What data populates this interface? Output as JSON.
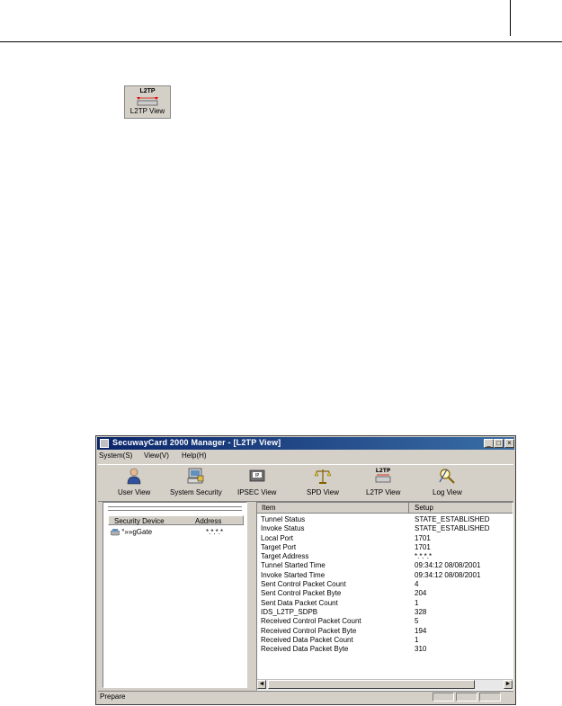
{
  "page": {
    "hero_icon_top": "L2TP",
    "hero_icon_label": "L2TP View"
  },
  "window": {
    "title": "SecuwayCard 2000 Manager - [L2TP View]",
    "menu": [
      "System(S)",
      "View(V)",
      "Help(H)"
    ],
    "toolbar": [
      {
        "label": "User View",
        "icon": "user-icon"
      },
      {
        "label": "System Security",
        "icon": "computer-lock-icon"
      },
      {
        "label": "IPSEC View",
        "icon": "ipsec-icon"
      },
      {
        "label": "SPD View",
        "icon": "scales-icon"
      },
      {
        "label": "L2TP View",
        "icon": "l2tp-icon"
      },
      {
        "label": "Log View",
        "icon": "magnifier-tools-icon"
      }
    ],
    "left": {
      "columns": [
        "Security Device",
        "Address"
      ],
      "rows": [
        {
          "device": "°»»gGate",
          "address": "*.*.*.*"
        }
      ]
    },
    "right": {
      "columns": [
        "Item",
        "Setup"
      ],
      "rows": [
        {
          "item": "Tunnel Status",
          "setup": "STATE_ESTABLISHED"
        },
        {
          "item": "Invoke Status",
          "setup": "STATE_ESTABLISHED"
        },
        {
          "item": "Local Port",
          "setup": "1701"
        },
        {
          "item": "Target Port",
          "setup": "1701"
        },
        {
          "item": "Target Address",
          "setup": "*.*.*.*"
        },
        {
          "item": "Tunnel Started Time",
          "setup": "09:34:12 08/08/2001"
        },
        {
          "item": "Invoke Started Time",
          "setup": "09:34:12 08/08/2001"
        },
        {
          "item": "Sent Control Packet Count",
          "setup": "4"
        },
        {
          "item": "Sent Control Packet Byte",
          "setup": "204"
        },
        {
          "item": "Sent Data Packet Count",
          "setup": "1"
        },
        {
          "item": "IDS_L2TP_SDPB",
          "setup": "328"
        },
        {
          "item": "Received Control Packet Count",
          "setup": "5"
        },
        {
          "item": "Received Control Packet Byte",
          "setup": "194"
        },
        {
          "item": "Received Data Packet Count",
          "setup": "1"
        },
        {
          "item": "Received Data Packet Byte",
          "setup": "310"
        }
      ]
    },
    "status": "Prepare"
  }
}
